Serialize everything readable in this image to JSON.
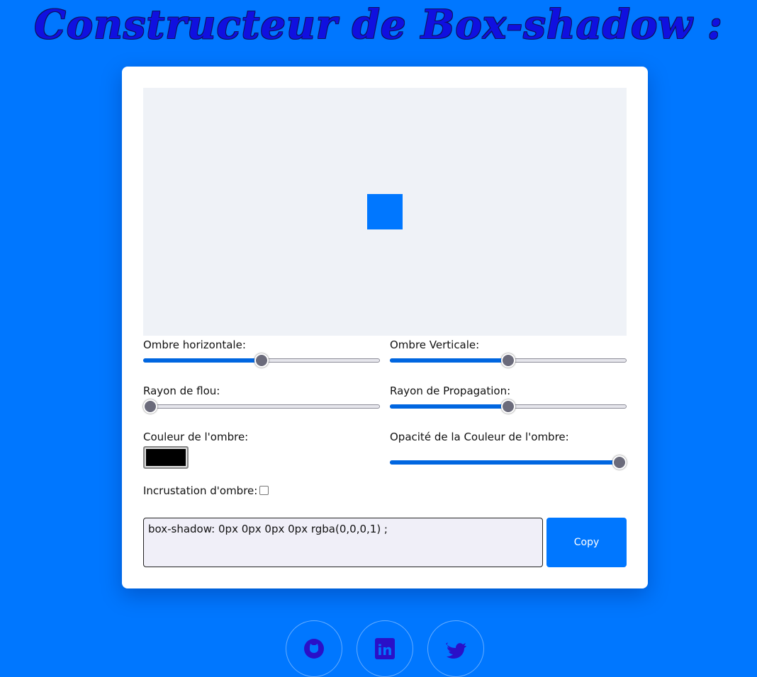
{
  "title": "Constructeur de Box-shadow :",
  "colors": {
    "background": "#0077ff",
    "accent": "#0066e0",
    "preview_box": "#0077ff",
    "shadow_color": "#000000"
  },
  "controls": {
    "horizontal": {
      "label": "Ombre horizontale:",
      "value_percent": 50
    },
    "vertical": {
      "label": "Ombre Verticale:",
      "value_percent": 50
    },
    "blur": {
      "label": "Rayon de flou:",
      "value_percent": 0
    },
    "spread": {
      "label": "Rayon de Propagation:",
      "value_percent": 50
    },
    "color": {
      "label": "Couleur de l'ombre:",
      "value": "#000000"
    },
    "opacity": {
      "label": "Opacité de la Couleur de l'ombre:",
      "value_percent": 100
    },
    "inset": {
      "label": "Incrustation d'ombre:",
      "checked": false
    }
  },
  "output": {
    "code": "box-shadow: 0px 0px 0px 0px rgba(0,0,0,1) ;",
    "copy_label": "Copy"
  },
  "social": [
    {
      "icon": "github-icon"
    },
    {
      "icon": "linkedin-icon",
      "text": "in"
    },
    {
      "icon": "twitter-icon"
    }
  ]
}
